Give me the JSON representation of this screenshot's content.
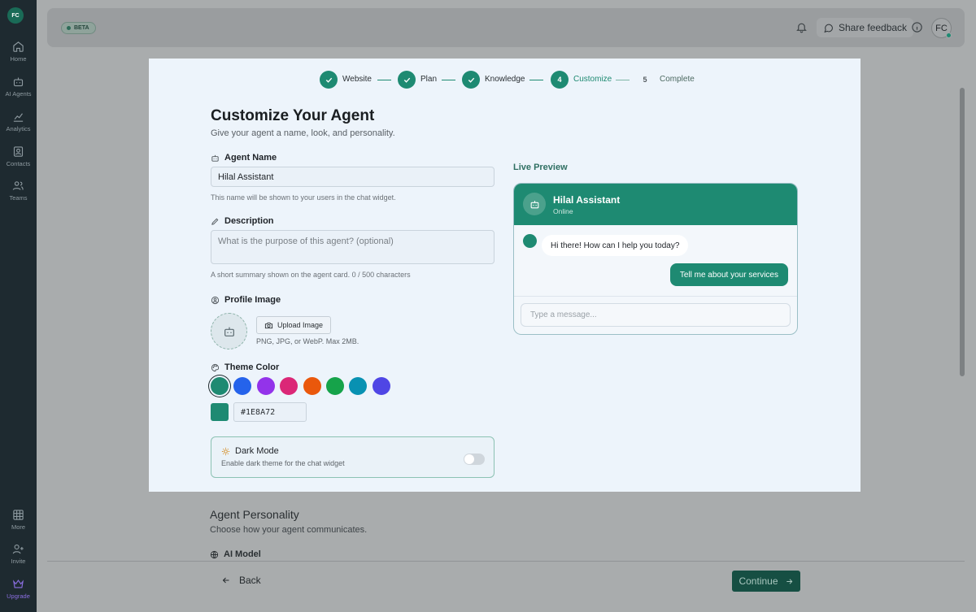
{
  "sidebar": {
    "avatar_initials": "FC",
    "items": [
      {
        "label": "Home",
        "icon": "home-icon"
      },
      {
        "label": "AI Agents",
        "icon": "robot-icon"
      },
      {
        "label": "Analytics",
        "icon": "chart-icon"
      },
      {
        "label": "Contacts",
        "icon": "contacts-icon"
      },
      {
        "label": "Teams",
        "icon": "users-icon"
      }
    ],
    "bottom_items": [
      {
        "label": "More",
        "icon": "grid-icon"
      },
      {
        "label": "Invite",
        "icon": "user-plus-icon"
      },
      {
        "label": "Upgrade",
        "icon": "crown-icon"
      }
    ]
  },
  "topbar": {
    "badge": "BETA",
    "share_label": "Share feedback",
    "user_initials": "FC"
  },
  "stepper": {
    "steps": [
      {
        "number": "1",
        "label": "Website",
        "state": "done"
      },
      {
        "number": "2",
        "label": "Plan",
        "state": "done"
      },
      {
        "number": "3",
        "label": "Knowledge",
        "state": "done"
      },
      {
        "number": "4",
        "label": "Customize",
        "state": "current"
      },
      {
        "number": "5",
        "label": "Complete",
        "state": "todo"
      }
    ]
  },
  "form": {
    "title": "Customize Your Agent",
    "subtitle": "Give your agent a name, look, and personality.",
    "agent_name": {
      "label": "Agent Name",
      "value": "Hilal Assistant",
      "hint": "This name will be shown to your users in the chat widget."
    },
    "description": {
      "label": "Description",
      "placeholder": "What is the purpose of this agent? (optional)",
      "hint": "A short summary shown on the agent card. 0 / 500 characters"
    },
    "profile_image": {
      "label": "Profile Image",
      "upload_label": "Upload Image",
      "hint": "PNG, JPG, or WebP. Max 2MB."
    },
    "theme_color": {
      "label": "Theme Color",
      "swatches": [
        "#1E8A72",
        "#2563EB",
        "#9333EA",
        "#DB2777",
        "#EA580C",
        "#16A34A",
        "#0891B2",
        "#4F46E5"
      ],
      "selected_index": 0,
      "hex_value": "#1E8A72"
    },
    "dark_mode": {
      "title": "Dark Mode",
      "subtitle": "Enable dark theme for the chat widget",
      "enabled": false
    }
  },
  "preview": {
    "label": "Live Preview",
    "agent_name": "Hilal Assistant",
    "status": "Online",
    "bot_message": "Hi there! How can I help you today?",
    "user_message": "Tell me about your services",
    "input_placeholder": "Type a message..."
  },
  "below": {
    "section_title": "Agent Personality",
    "section_subtitle": "Choose how your agent communicates.",
    "ai_model_label": "AI Model"
  },
  "footer": {
    "back_label": "Back",
    "continue_label": "Continue"
  },
  "colors": {
    "accent": "#1E8A72",
    "sidebar_bg": "#1E2A30",
    "panel_bg": "#EDF4FB"
  }
}
